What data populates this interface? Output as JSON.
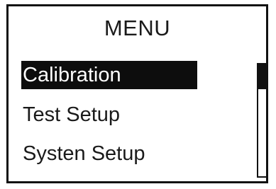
{
  "menu": {
    "title": "MENU",
    "items": [
      {
        "label": "Calibration",
        "selected": true
      },
      {
        "label": "Test Setup",
        "selected": false
      },
      {
        "label": "Systen Setup",
        "selected": false
      }
    ]
  },
  "scrollbar": {
    "position_fraction": 0.0,
    "visible_fraction": 0.22
  },
  "colors": {
    "foreground": "#111111",
    "background": "#ffffff",
    "selection_bg": "#0d0d0d",
    "selection_fg": "#ffffff"
  }
}
